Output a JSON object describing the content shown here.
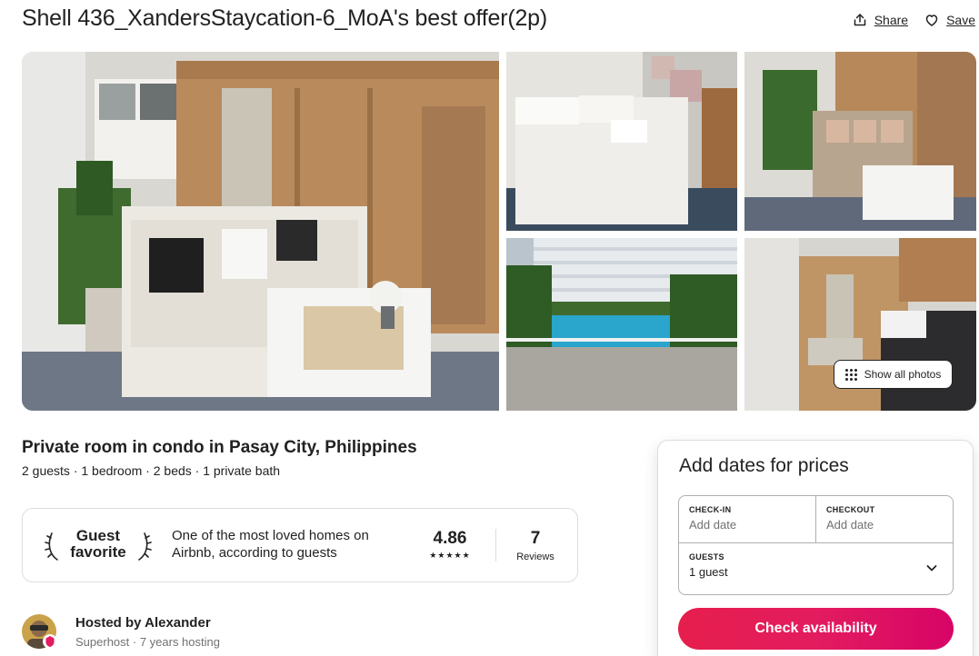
{
  "listing": {
    "title": "Shell 436_XandersStaycation-6_MoA's best offer(2p)",
    "subtitle": "Private room in condo in Pasay City, Philippines",
    "details": "2 guests · 1 bedroom · 2 beds · 1 private bath"
  },
  "actions": {
    "share_label": "Share",
    "save_label": "Save"
  },
  "gallery": {
    "show_all_label": "Show all photos"
  },
  "guest_favorite": {
    "badge_line1": "Guest",
    "badge_line2": "favorite",
    "description": "One of the most loved homes on Airbnb, according to guests",
    "rating": "4.86",
    "stars": "★★★★★",
    "reviews_count": "7",
    "reviews_label": "Reviews"
  },
  "host": {
    "name": "Hosted by Alexander",
    "meta": "Superhost · 7 years hosting"
  },
  "booking": {
    "title": "Add dates for prices",
    "checkin_label": "CHECK-IN",
    "checkin_value": "Add date",
    "checkout_label": "CHECKOUT",
    "checkout_value": "Add date",
    "guests_label": "GUESTS",
    "guests_value": "1 guest",
    "button_label": "Check availability"
  },
  "colors": {
    "brand": "#E31C5F",
    "text": "#222222",
    "muted": "#717171",
    "border": "#DDDDDD"
  }
}
